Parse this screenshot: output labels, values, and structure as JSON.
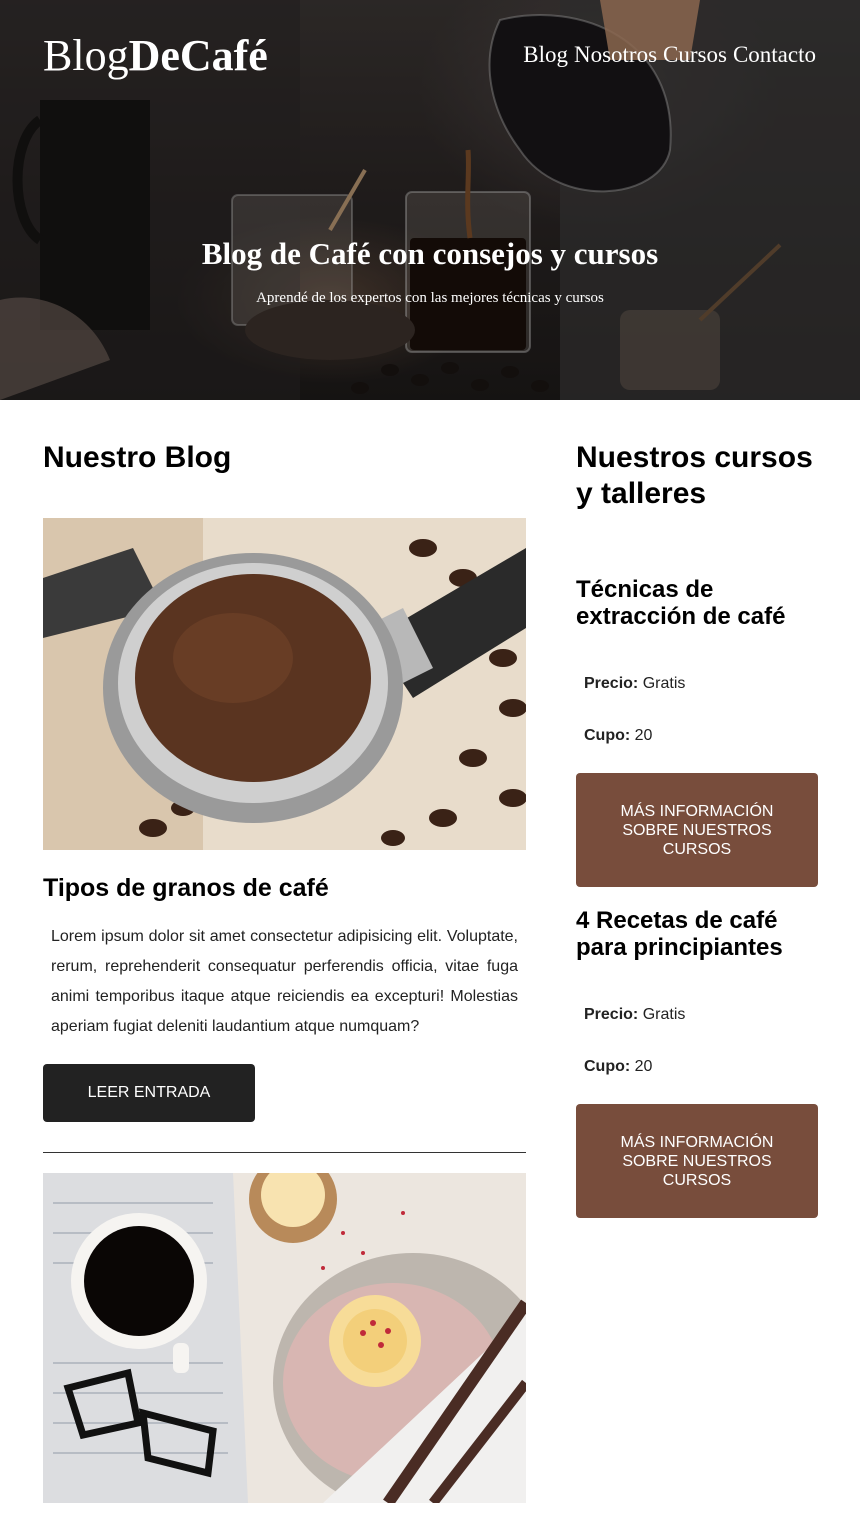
{
  "header": {
    "logo_part1": "Blog",
    "logo_part2": "DeCafé",
    "nav": [
      "Blog",
      "Nosotros",
      "Cursos",
      "Contacto"
    ],
    "hero_title": "Blog de Café con consejos y cursos",
    "hero_subtitle": "Aprendé de los expertos con las mejores técnicas y cursos"
  },
  "blog": {
    "section_title": "Nuestro Blog",
    "posts": [
      {
        "title": "Tipos de granos de café",
        "text": "Lorem ipsum dolor sit amet consectetur adipisicing elit. Voluptate, rerum, reprehenderit consequatur perferendis officia, vitae fuga animi temporibus itaque atque reiciendis ea excepturi! Molestias aperiam fugiat deleniti laudantium atque numquam?",
        "button": "LEER ENTRADA"
      }
    ]
  },
  "courses": {
    "section_title": "Nuestros cursos y talleres",
    "price_label": "Precio:",
    "quota_label": "Cupo:",
    "items": [
      {
        "title": "Técnicas de extracción de café",
        "price": "Gratis",
        "quota": "20",
        "button": "MÁS INFORMACIÓN SOBRE NUESTROS CURSOS"
      },
      {
        "title": "4 Recetas de café para principiantes",
        "price": "Gratis",
        "quota": "20",
        "button": "MÁS INFORMACIÓN SOBRE NUESTROS CURSOS"
      }
    ]
  },
  "colors": {
    "accent_brown": "#784d3c",
    "button_dark": "#222222"
  }
}
